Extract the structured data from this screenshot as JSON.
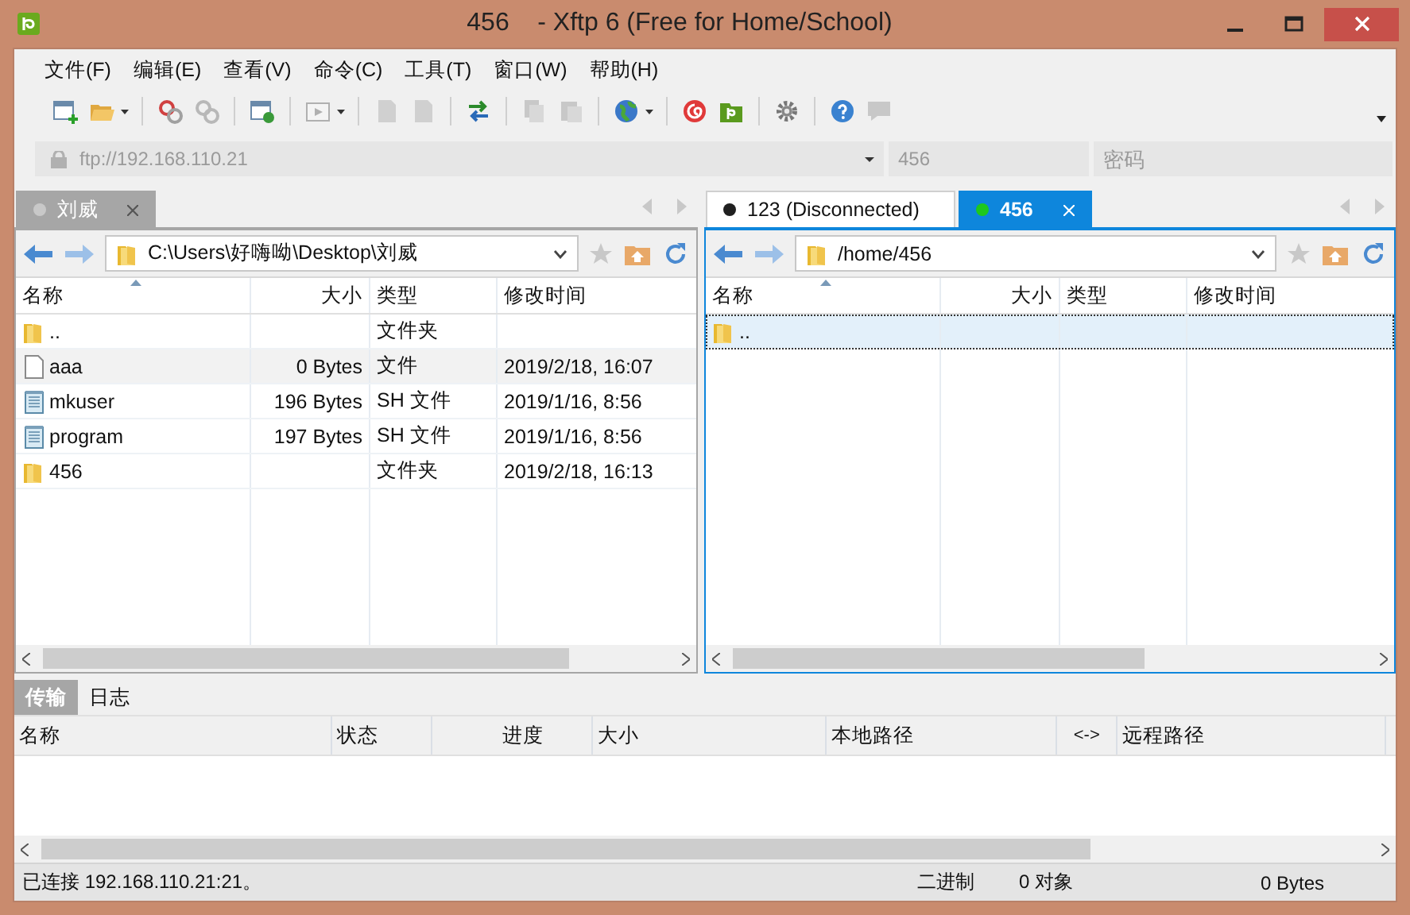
{
  "window": {
    "title": "456    - Xftp 6 (Free for Home/School)"
  },
  "menu": [
    "文件(F)",
    "编辑(E)",
    "查看(V)",
    "命令(C)",
    "工具(T)",
    "窗口(W)",
    "帮助(H)"
  ],
  "address": {
    "host": "ftp://192.168.110.21",
    "username": "456",
    "password_placeholder": "密码"
  },
  "panels": [
    {
      "focused": false,
      "tabs": [
        {
          "label": "刘威",
          "selected": true,
          "color": "#c8c8c8"
        }
      ],
      "path": "C:\\Users\\好嗨呦\\Desktop\\刘威",
      "columns": [
        "名称",
        "大小",
        "类型",
        "修改时间"
      ],
      "rows": [
        {
          "kind": "folder",
          "name": "..",
          "size": "",
          "type": "文件夹",
          "modified": "",
          "selected": false,
          "hovered": false
        },
        {
          "kind": "file",
          "name": "aaa",
          "size": "0 Bytes",
          "type": "文件",
          "modified": "2019/2/18, 16:07",
          "selected": false,
          "hovered": true
        },
        {
          "kind": "script",
          "name": "mkuser",
          "size": "196 Bytes",
          "type": "SH 文件",
          "modified": "2019/1/16, 8:56",
          "selected": false,
          "hovered": false
        },
        {
          "kind": "script",
          "name": "program",
          "size": "197 Bytes",
          "type": "SH 文件",
          "modified": "2019/1/16, 8:56",
          "selected": false,
          "hovered": false
        },
        {
          "kind": "folder",
          "name": "456",
          "size": "",
          "type": "文件夹",
          "modified": "2019/2/18, 16:13",
          "selected": false,
          "hovered": false
        }
      ]
    },
    {
      "focused": true,
      "tabs": [
        {
          "label": "123 (Disconnected)",
          "selected": false,
          "color": "#202020"
        },
        {
          "label": "456",
          "selected": true,
          "color": "#1ec81e"
        }
      ],
      "path": "/home/456",
      "columns": [
        "名称",
        "大小",
        "类型",
        "修改时间"
      ],
      "rows": [
        {
          "kind": "folder",
          "name": "..",
          "size": "",
          "type": "",
          "modified": "",
          "selected": true,
          "hovered": false
        }
      ]
    }
  ],
  "transfer": {
    "tabs": [
      {
        "label": "传输",
        "selected": true
      },
      {
        "label": "日志",
        "selected": false
      }
    ],
    "columns": [
      "名称",
      "状态",
      "进度",
      "大小",
      "本地路径",
      "<->",
      "远程路径"
    ]
  },
  "status_bar": {
    "message": "已连接 192.168.110.21:21。",
    "mode": "二进制",
    "objects": "0 对象",
    "size": "0 Bytes"
  }
}
